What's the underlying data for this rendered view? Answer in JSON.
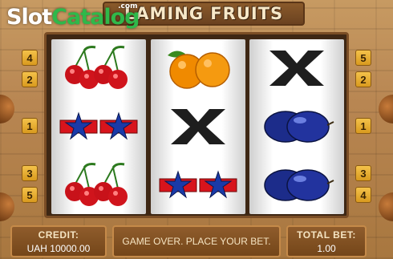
{
  "logo": {
    "slot": "Slot",
    "catalog": "Catalog",
    "com": ".com"
  },
  "game": {
    "title": "LAMING FRUITS"
  },
  "lines_left": [
    "4",
    "2",
    "1",
    "3",
    "5"
  ],
  "lines_right": [
    "5",
    "2",
    "1",
    "3",
    "4"
  ],
  "reels": [
    [
      "cherries",
      "stars",
      "cherries"
    ],
    [
      "oranges",
      "x",
      "stars"
    ],
    [
      "x",
      "plums",
      "plums"
    ]
  ],
  "credit": {
    "label": "CREDIT:",
    "value": "UAH 10000.00"
  },
  "message": "GAME OVER. PLACE YOUR BET.",
  "total_bet": {
    "label": "TOTAL BET:",
    "value": "1.00"
  },
  "colors": {
    "badge": "#f4c24a",
    "panel": "#8f5c2c",
    "frame": "#3e2714"
  }
}
